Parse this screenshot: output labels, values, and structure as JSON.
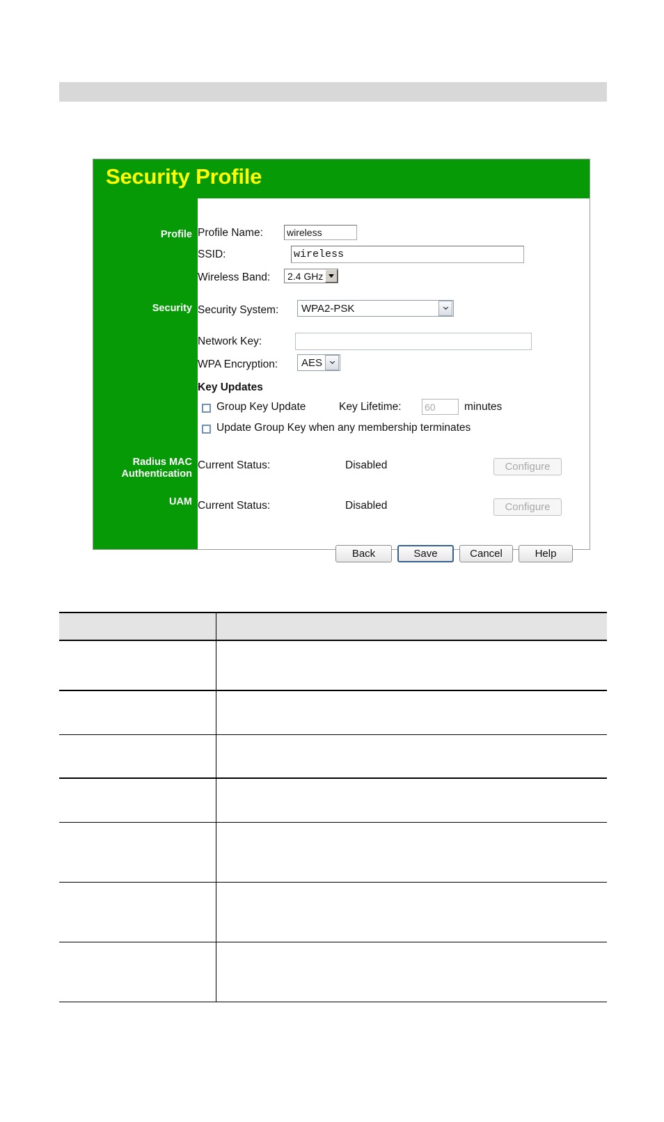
{
  "page": {
    "top_bar_label": ""
  },
  "panel": {
    "title": "Security Profile",
    "sidebar": {
      "profile": "Profile",
      "security": "Security",
      "radius_line1": "Radius MAC",
      "radius_line2": "Authentication",
      "uam": "UAM"
    },
    "fields": {
      "profile_name_label": "Profile Name:",
      "profile_name_value": "wireless",
      "ssid_label": "SSID:",
      "ssid_value": "wireless",
      "wireless_band_label": "Wireless Band:",
      "wireless_band_value": "2.4 GHz",
      "security_system_label": "Security System:",
      "security_system_value": "WPA2-PSK",
      "network_key_label": "Network Key:",
      "network_key_value": "",
      "wpa_encryption_label": "WPA Encryption:",
      "wpa_encryption_value": "AES",
      "key_updates_heading": "Key Updates",
      "group_key_update_label": "Group Key Update",
      "key_lifetime_label": "Key Lifetime:",
      "key_lifetime_value": "60",
      "key_lifetime_units": "minutes",
      "update_group_key_label": "Update Group Key when any membership terminates",
      "radius_status_label": "Current Status:",
      "radius_status_value": "Disabled",
      "radius_configure_label": "Configure",
      "uam_status_label": "Current Status:",
      "uam_status_value": "Disabled",
      "uam_configure_label": "Configure"
    },
    "buttons": {
      "back": "Back",
      "save": "Save",
      "cancel": "Cancel",
      "help": "Help"
    },
    "colors": {
      "panel_green": "#069A06",
      "title_yellow": "#ffff00",
      "top_bar_gray": "#d8d8d8",
      "table_header_gray": "#e4e4e4"
    }
  },
  "desc_table": {
    "header_cells": [
      "",
      ""
    ],
    "rows": [
      {
        "term": "",
        "description": ""
      },
      {
        "term": "",
        "description": ""
      },
      {
        "term": "",
        "description": ""
      },
      {
        "term": "",
        "description": ""
      },
      {
        "term": "",
        "description": ""
      },
      {
        "term": "",
        "description": ""
      },
      {
        "term": "",
        "description": ""
      }
    ]
  }
}
